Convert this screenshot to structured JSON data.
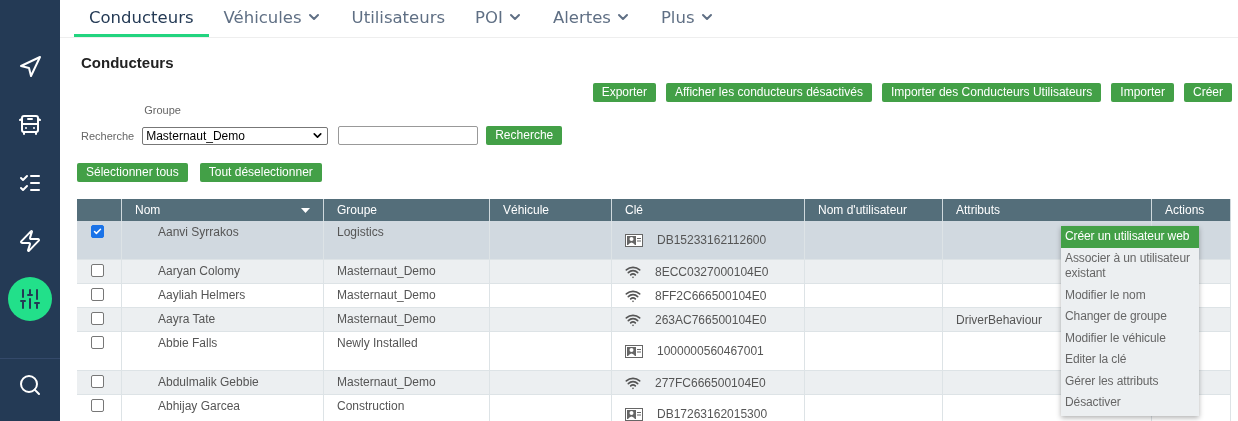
{
  "sidebar": {
    "items": [
      {
        "selected": false
      },
      {
        "selected": false
      },
      {
        "selected": false
      },
      {
        "selected": false
      },
      {
        "selected": true
      }
    ],
    "bottom_items": [
      {
        "selected": false
      }
    ]
  },
  "nav_tabs": [
    {
      "label": "Conducteurs",
      "selected": true,
      "has_dropdown": false
    },
    {
      "label": "Véhicules",
      "selected": false,
      "has_dropdown": true
    },
    {
      "label": "Utilisateurs",
      "selected": false,
      "has_dropdown": false
    },
    {
      "label": "POI",
      "selected": false,
      "has_dropdown": true
    },
    {
      "label": "Alertes",
      "selected": false,
      "has_dropdown": true
    },
    {
      "label": "Plus",
      "selected": false,
      "has_dropdown": true
    }
  ],
  "page_title": "Conducteurs",
  "toolbar_buttons": [
    "Exporter",
    "Afficher les conducteurs désactivés",
    "Importer des Conducteurs Utilisateurs",
    "Importer",
    "Créer"
  ],
  "filters": {
    "group_label": "Groupe",
    "search_label": "Recherche",
    "group_value": "Masternaut_Demo",
    "search_button": "Recherche"
  },
  "selection_buttons": [
    "Sélectionner tous",
    "Tout déselectionner"
  ],
  "table": {
    "columns": [
      {
        "label": "Nom",
        "sortable": true
      },
      {
        "label": "Groupe",
        "sortable": false
      },
      {
        "label": "Véhicule",
        "sortable": false
      },
      {
        "label": "Clé",
        "sortable": false
      },
      {
        "label": "Nom d'utilisateur",
        "sortable": false
      },
      {
        "label": "Attributs",
        "sortable": false
      },
      {
        "label": "Actions",
        "sortable": false
      }
    ],
    "rows": [
      {
        "checked": true,
        "name": "Aanvi Syrrakos",
        "group": "Logistics",
        "kind": "card",
        "key": "DB15233162112600",
        "attributes": ""
      },
      {
        "checked": false,
        "name": "Aaryan Colomy",
        "group": "Masternaut_Demo",
        "kind": "wifi",
        "key": "8ECC0327000104E0",
        "attributes": ""
      },
      {
        "checked": false,
        "name": "Aayliah Helmers",
        "group": "Masternaut_Demo",
        "kind": "wifi",
        "key": "8FF2C666500104E0",
        "attributes": ""
      },
      {
        "checked": false,
        "name": "Aayra Tate",
        "group": "Masternaut_Demo",
        "kind": "wifi",
        "key": "263AC766500104E0",
        "attributes": "DriverBehaviour"
      },
      {
        "checked": false,
        "name": "Abbie Falls",
        "group": "Newly Installed",
        "kind": "card",
        "key": "1000000560467001",
        "attributes": ""
      },
      {
        "checked": false,
        "name": "Abdulmalik Gebbie",
        "group": "Masternaut_Demo",
        "kind": "wifi",
        "key": "277FC666500104E0",
        "attributes": ""
      },
      {
        "checked": false,
        "name": "Abhijay Garcea",
        "group": "Construction",
        "kind": "card",
        "key": "DB17263162015300",
        "attributes": ""
      }
    ]
  },
  "action_menu": {
    "items": [
      {
        "label": "Créer un utilisateur web",
        "selected": true
      },
      {
        "label": "Associer à un utilisateur existant",
        "selected": false
      },
      {
        "label": "Modifier le nom",
        "selected": false
      },
      {
        "label": "Changer de groupe",
        "selected": false
      },
      {
        "label": "Modifier le véhicule",
        "selected": false
      },
      {
        "label": "Editer la clé",
        "selected": false
      },
      {
        "label": "Gérer les attributs",
        "selected": false
      },
      {
        "label": "Désactiver",
        "selected": false
      }
    ]
  }
}
